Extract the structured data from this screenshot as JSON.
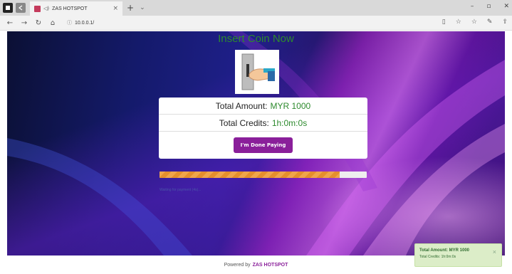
{
  "browser": {
    "tab_title": "ZAS HOTSPOT",
    "tab_sound_icon": "speaker-icon",
    "tab_close": "×",
    "new_tab": "+",
    "url": "10.0.0.1/"
  },
  "portal": {
    "heading": "Insert Coin Now",
    "total_amount_label": "Total Amount:",
    "total_amount_value": "MYR 1000",
    "total_credits_label": "Total Credits:",
    "total_credits_value": "1h:0m:0s",
    "done_button": "I'm Done Paying",
    "progress_fraction": 0.87,
    "waiting_text": "Waiting for payment (4s)..."
  },
  "footer": {
    "powered_by": "Powered by",
    "brand": "ZAS HOTSPOT"
  },
  "toast": {
    "line1": "Total Amount: MYR 1000",
    "line2": "Total Credits: 1h:0m:0s",
    "close": "×"
  },
  "colors": {
    "accent_purple": "#8a1f9a",
    "value_green": "#2d8a2d",
    "progress_orange": "#f0a54a",
    "toast_bg": "#dcedc8"
  }
}
